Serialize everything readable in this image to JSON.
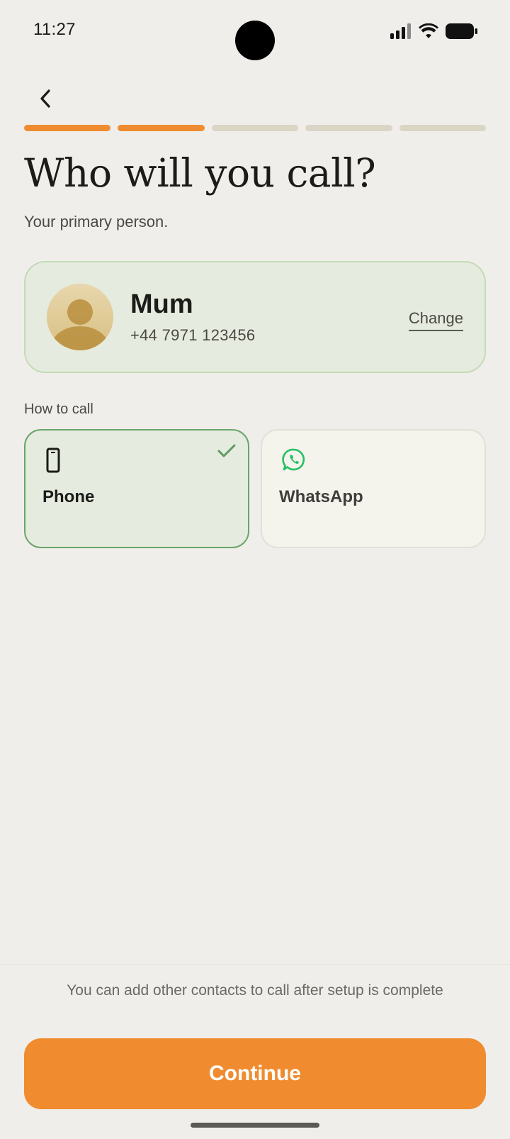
{
  "status_bar": {
    "time": "11:27",
    "icons": [
      "signal-icon",
      "wifi-icon",
      "battery-icon"
    ]
  },
  "navigation": {
    "back_icon": "chevron-left-icon"
  },
  "progress": {
    "total_steps": 5,
    "completed_steps": 2,
    "active_color": "#ef8c31",
    "inactive_color": "#dbd5c6"
  },
  "header": {
    "title": "Who will you call?",
    "subtitle": "Your primary person."
  },
  "contact": {
    "name": "Mum",
    "phone": "+44 7971 123456",
    "change_label": "Change",
    "avatar_icon": "person-avatar-icon"
  },
  "call_method": {
    "label": "How to call",
    "options": [
      {
        "label": "Phone",
        "icon": "mobile-phone-icon",
        "selected": true
      },
      {
        "label": "WhatsApp",
        "icon": "whatsapp-icon",
        "selected": false
      }
    ]
  },
  "footer": {
    "note": "You can add other contacts to call after setup is complete",
    "continue_label": "Continue",
    "accent_color": "#f08c2f"
  }
}
